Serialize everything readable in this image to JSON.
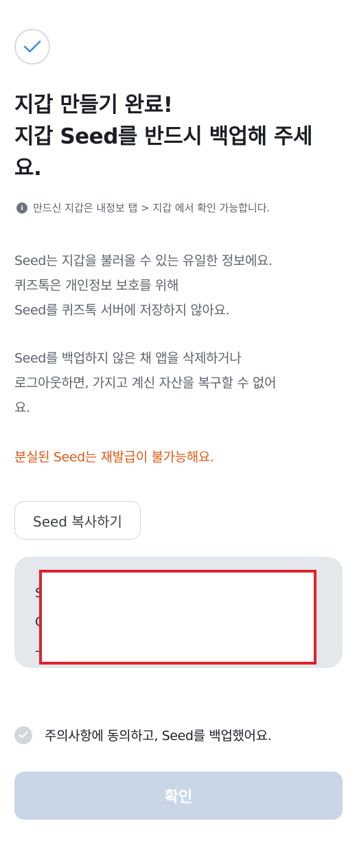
{
  "header": {
    "check_icon": "check-icon",
    "title_lines": [
      "지갑 만들기 완료!",
      "지갑 Seed를 반드시 백업해 주세",
      "요."
    ]
  },
  "info": {
    "icon": "info-icon",
    "icon_glyph": "i",
    "text": "만드신 지갑은 내정보 탭 > 지갑 에서 확인 가능합니다."
  },
  "body": {
    "para1": [
      "Seed는 지갑을 불러올 수 있는 유일한 정보에요.",
      "퀴즈톡은 개인정보 보호를 위해",
      "Seed를 퀴즈톡 서버에 저장하지 않아요."
    ],
    "para2": [
      "Seed를 백업하지 않은 채 앱을 삭제하거나",
      "로그아웃하면, 가지고 계신 자산을 복구할  수 없어",
      "요."
    ],
    "warning": "분실된 Seed는 재발급이 불가능해요."
  },
  "seed": {
    "copy_label": "Seed 복사하기",
    "visible_chars": [
      "S",
      "C",
      "-"
    ]
  },
  "agree": {
    "icon": "check-circle-icon",
    "label": "주의사항에 동의하고, Seed를 백업했어요."
  },
  "confirm_label": "확인",
  "colors": {
    "accent_check": "#3d8ee6",
    "warning": "#de5a14",
    "confirm_disabled": "#c8d6e6",
    "redaction_border": "#e0202a"
  }
}
